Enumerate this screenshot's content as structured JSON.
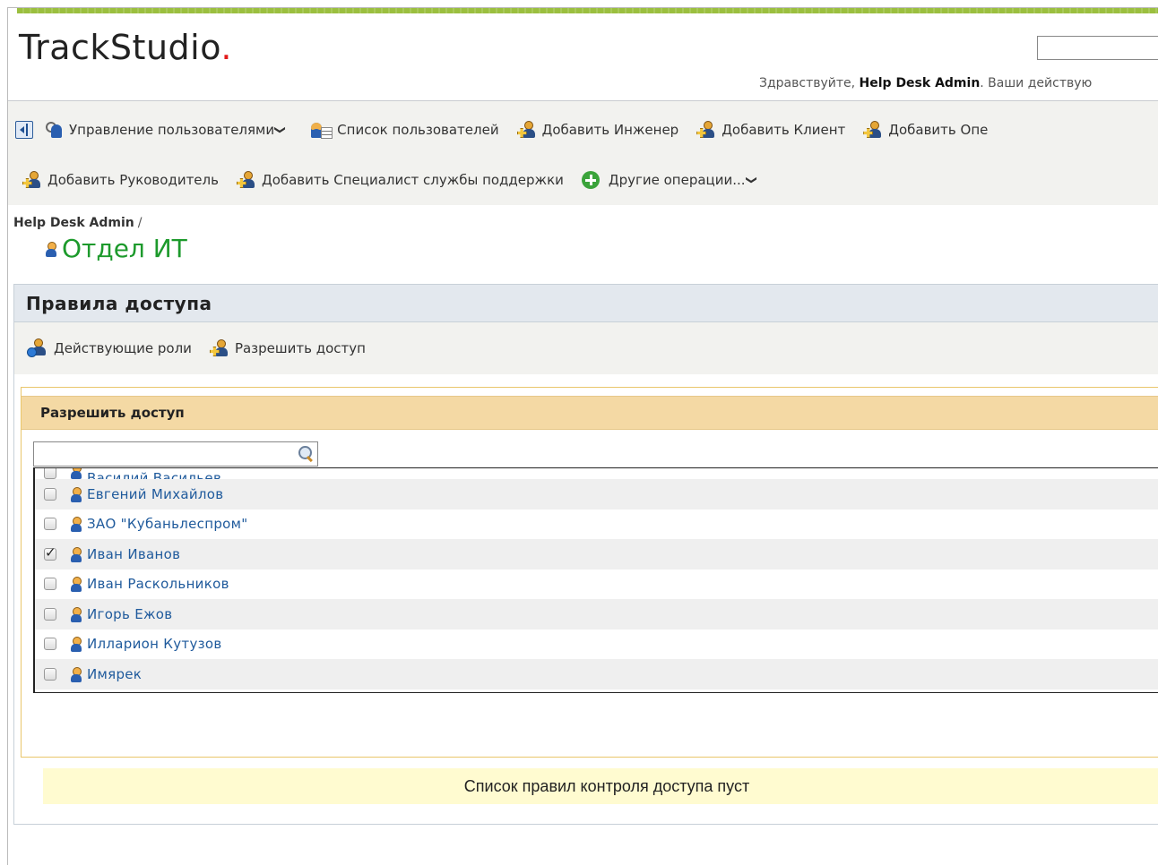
{
  "header": {
    "logo_text": "TrackStudio",
    "logo_dot": ".",
    "greeting_prefix": "Здравствуйте, ",
    "greeting_user": "Help Desk Admin",
    "greeting_suffix": ". Ваши действую"
  },
  "toolbar": {
    "row1": [
      {
        "label": "Управление пользователями",
        "icon": "user-management-icon",
        "dropdown": true
      },
      {
        "label": "Список пользователей",
        "icon": "user-list-icon"
      },
      {
        "label": "Добавить Инженер",
        "icon": "add-user-icon"
      },
      {
        "label": "Добавить Клиент",
        "icon": "add-user-icon"
      },
      {
        "label": "Добавить Опе",
        "icon": "add-user-icon"
      }
    ],
    "row2": [
      {
        "label": "Добавить Руководитель",
        "icon": "add-user-icon"
      },
      {
        "label": "Добавить Специалист службы поддержки",
        "icon": "add-user-icon"
      },
      {
        "label": "Другие операции...",
        "icon": "green-plus-icon",
        "dropdown": true
      }
    ]
  },
  "breadcrumb": {
    "root": "Help Desk Admin",
    "separator": "/"
  },
  "page": {
    "title": "Отдел ИТ"
  },
  "access": {
    "panel_title": "Правила доступа",
    "actions": [
      {
        "label": "Действующие роли",
        "icon": "roles-info-icon"
      },
      {
        "label": "Разрешить доступ",
        "icon": "add-user-icon"
      }
    ],
    "grant": {
      "title": "Разрешить доступ",
      "search_value": "",
      "users": [
        {
          "name": "Василий Васильев",
          "checked": false,
          "partial": true
        },
        {
          "name": "Евгений Михайлов",
          "checked": false
        },
        {
          "name": "ЗАО \"Кубаньлеспром\"",
          "checked": false
        },
        {
          "name": "Иван Иванов",
          "checked": true
        },
        {
          "name": "Иван Раскольников",
          "checked": false
        },
        {
          "name": "Игорь Ежов",
          "checked": false
        },
        {
          "name": "Илларион Кутузов",
          "checked": false
        },
        {
          "name": "Имярек",
          "checked": false
        }
      ]
    },
    "empty_message": "Список правил контроля доступа пуст"
  }
}
